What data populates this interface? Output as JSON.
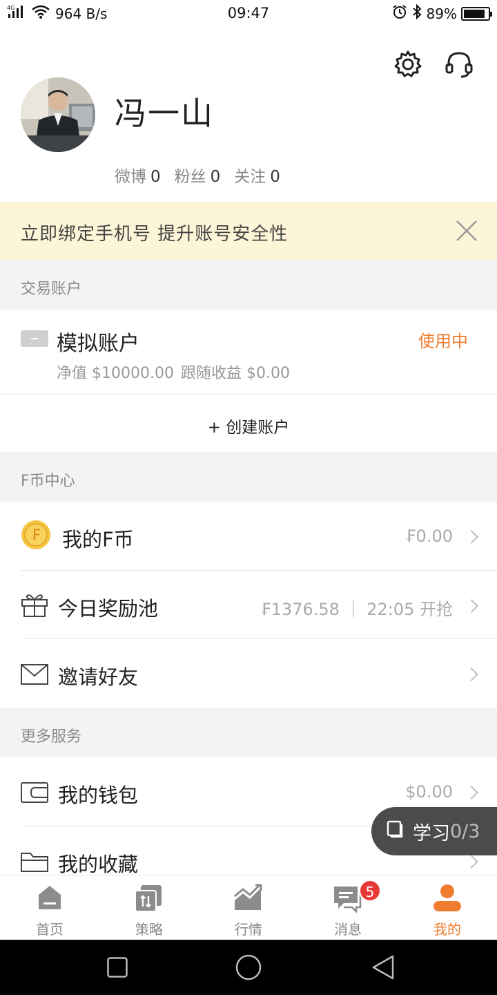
{
  "status_bar": {
    "network": "4G",
    "speed": "964 B/s",
    "time": "09:47",
    "battery": "89%",
    "battery_level": 0.89
  },
  "profile": {
    "name": "冯一山",
    "weibo_label": "微博",
    "weibo_count": "0",
    "fans_label": "粉丝",
    "fans_count": "0",
    "follow_label": "关注",
    "follow_count": "0"
  },
  "banner": {
    "text": "立即绑定手机号 提升账号安全性"
  },
  "trading": {
    "section_title": "交易账户",
    "account_name": "模拟账户",
    "status": "使用中",
    "net_value": "净值 $10000.00",
    "follow_profit": "跟随收益 $0.00",
    "create_label": "+ 创建账户"
  },
  "fcoin": {
    "section_title": "F币中心",
    "my_fcoin_label": "我的F币",
    "my_fcoin_value": "₣0.00",
    "reward_label": "今日奖励池",
    "reward_value": "₣1376.58 ｜ 22:05 开抢",
    "invite_label": "邀请好友"
  },
  "services": {
    "section_title": "更多服务",
    "wallet_label": "我的钱包",
    "wallet_value": "$0.00",
    "favorites_label": "我的收藏"
  },
  "floating": {
    "label": "学习",
    "progress": "0/3"
  },
  "tabs": [
    {
      "label": "首页"
    },
    {
      "label": "策略"
    },
    {
      "label": "行情"
    },
    {
      "label": "消息",
      "badge": "5"
    },
    {
      "label": "我的"
    }
  ],
  "colors": {
    "accent": "#f07c30",
    "badge": "#e53935",
    "banner_bg": "#fdf5d7"
  }
}
